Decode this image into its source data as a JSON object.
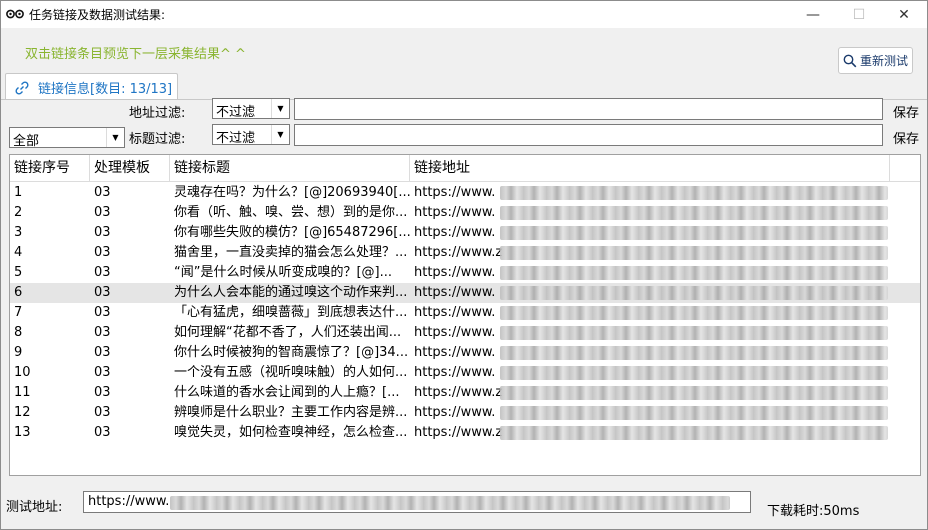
{
  "window": {
    "title": "任务链接及数据测试结果:"
  },
  "hint": "双击链接条目预览下一层采集结果^ ^",
  "retest_label": "重新测试",
  "tab_label": "链接信息[数目: 13/13]",
  "filters": {
    "scope_value": "全部",
    "address_label": "地址过滤:",
    "address_mode": "不过滤",
    "title_label": "标题过滤:",
    "title_mode": "不过滤",
    "save_label": "保存"
  },
  "table": {
    "columns": [
      "链接序号",
      "处理模板",
      "链接标题",
      "链接地址"
    ],
    "selected_index": 5,
    "rows": [
      {
        "no": "1",
        "tpl": "03",
        "title": "灵魂存在吗？为什么？[@]20693940[...",
        "url": "https://www."
      },
      {
        "no": "2",
        "tpl": "03",
        "title": "你看（听、触、嗅、尝、想）到的是你...",
        "url": "https://www."
      },
      {
        "no": "3",
        "tpl": "03",
        "title": "你有哪些失败的模仿？[@]65487296[...",
        "url": "https://www."
      },
      {
        "no": "4",
        "tpl": "03",
        "title": "猫舍里，一直没卖掉的猫会怎么处理？...",
        "url": "https://www.z"
      },
      {
        "no": "5",
        "tpl": "03",
        "title": "“闻”是什么时候从听变成嗅的？[@]...",
        "url": "https://www."
      },
      {
        "no": "6",
        "tpl": "03",
        "title": "为什么人会本能的通过嗅这个动作来判...",
        "url": "https://www."
      },
      {
        "no": "7",
        "tpl": "03",
        "title": "「心有猛虎，细嗅蔷薇」到底想表达什...",
        "url": "https://www."
      },
      {
        "no": "8",
        "tpl": "03",
        "title": "如何理解“花都不香了，人们还装出闻...",
        "url": "https://www."
      },
      {
        "no": "9",
        "tpl": "03",
        "title": "你什么时候被狗的智商震惊了？[@]34...",
        "url": "https://www."
      },
      {
        "no": "10",
        "tpl": "03",
        "title": "一个没有五感（视听嗅味触）的人如何...",
        "url": "https://www."
      },
      {
        "no": "11",
        "tpl": "03",
        "title": "什么味道的香水会让闻到的人上瘾？[...",
        "url": "https://www.z"
      },
      {
        "no": "12",
        "tpl": "03",
        "title": "辨嗅师是什么职业？主要工作内容是辨...",
        "url": "https://www."
      },
      {
        "no": "13",
        "tpl": "03",
        "title": "嗅觉失灵，如何检查嗅神经，怎么检查...",
        "url": "https://www.z"
      }
    ]
  },
  "footer": {
    "test_url_label": "测试地址:",
    "test_url_value": "https://www.",
    "download_time": "下载耗时:50ms"
  }
}
